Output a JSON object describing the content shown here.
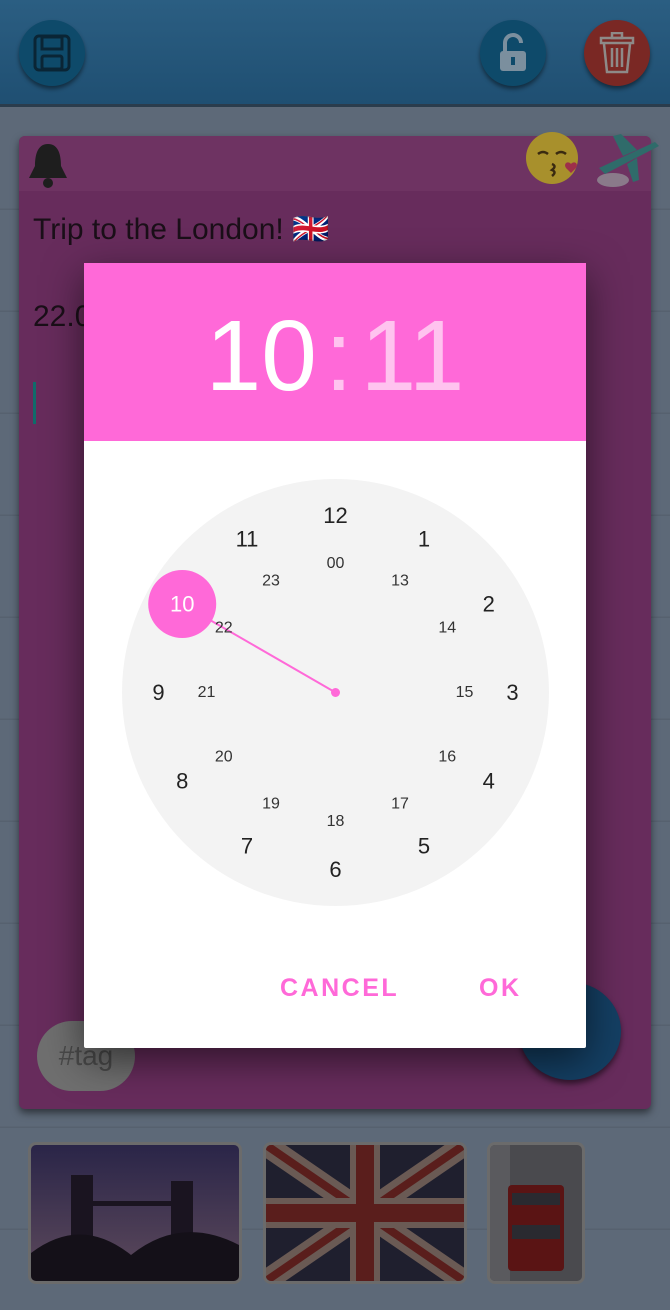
{
  "toolbar": {
    "save_icon": "floppy-disk-icon",
    "lock_icon": "unlock-icon",
    "trash_icon": "trash-icon"
  },
  "note": {
    "title": "Trip to the London! 🇬🇧",
    "date_partial": "22.0",
    "tag": "#tag",
    "header_icons": [
      "bell-icon",
      "kissing-emoji-icon",
      "airplane-icon"
    ],
    "color": "#672c5c"
  },
  "dialog": {
    "hour": "10",
    "separator": ":",
    "minute": "11",
    "cancel_label": "CANCEL",
    "ok_label": "OK",
    "accent_color": "#ff69d8",
    "outer_hours": [
      "12",
      "1",
      "2",
      "3",
      "4",
      "5",
      "6",
      "7",
      "8",
      "9",
      "10",
      "11"
    ],
    "inner_hours": [
      "00",
      "13",
      "14",
      "15",
      "16",
      "17",
      "18",
      "19",
      "20",
      "21",
      "22",
      "23"
    ],
    "selected_hour": "10"
  },
  "thumbnails": [
    "tower-bridge-photo",
    "union-jack-photo",
    "london-bus-photo"
  ]
}
